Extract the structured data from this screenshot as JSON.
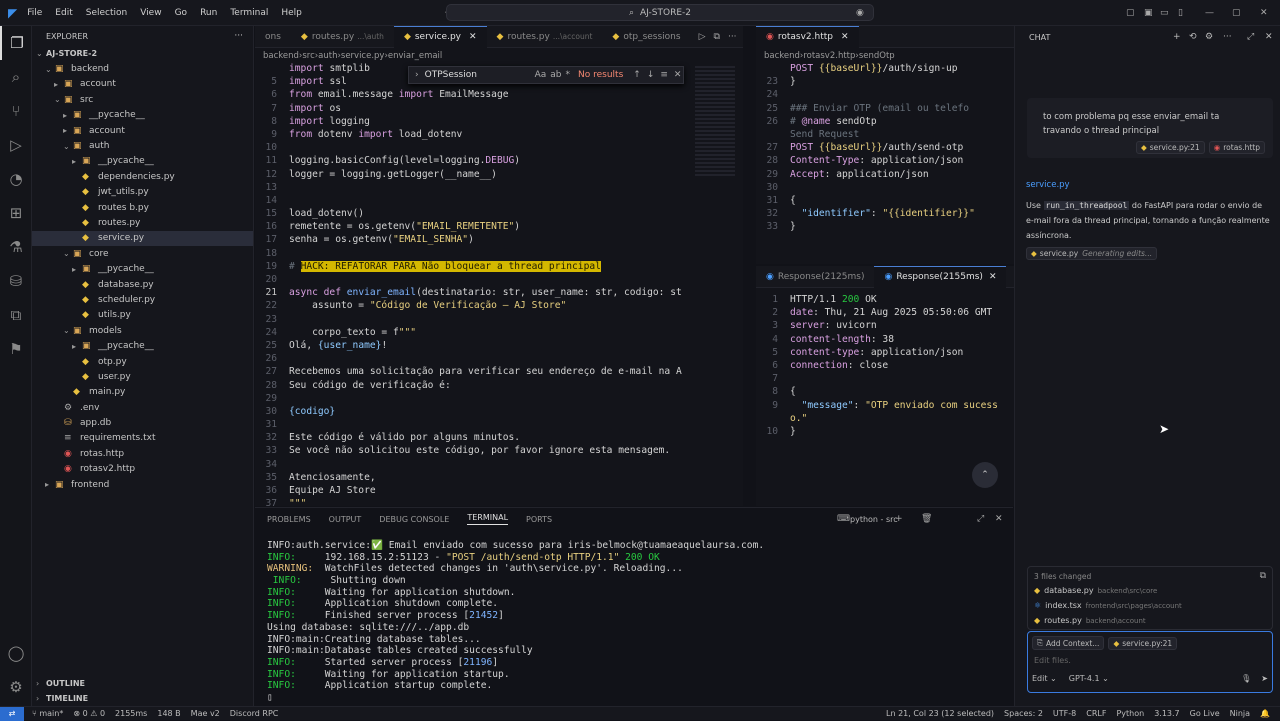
{
  "titlebar": {
    "menu": [
      "File",
      "Edit",
      "Selection",
      "View",
      "Go",
      "Run",
      "Terminal",
      "Help"
    ],
    "search": "AJ-STORE-2"
  },
  "explorer": {
    "header": "EXPLORER",
    "root": "AJ-STORE-2",
    "outline": "OUTLINE",
    "timeline": "TIMELINE",
    "items": [
      {
        "label": "backend",
        "depth": 1,
        "type": "folder-open"
      },
      {
        "label": "account",
        "depth": 2,
        "type": "folder"
      },
      {
        "label": "src",
        "depth": 2,
        "type": "folder-open"
      },
      {
        "label": "__pycache__",
        "depth": 3,
        "type": "folder"
      },
      {
        "label": "account",
        "depth": 3,
        "type": "folder"
      },
      {
        "label": "auth",
        "depth": 3,
        "type": "folder-open"
      },
      {
        "label": "__pycache__",
        "depth": 4,
        "type": "folder"
      },
      {
        "label": "dependencies.py",
        "depth": 4,
        "type": "py"
      },
      {
        "label": "jwt_utils.py",
        "depth": 4,
        "type": "py"
      },
      {
        "label": "routes b.py",
        "depth": 4,
        "type": "py"
      },
      {
        "label": "routes.py",
        "depth": 4,
        "type": "py"
      },
      {
        "label": "service.py",
        "depth": 4,
        "type": "py",
        "selected": true
      },
      {
        "label": "core",
        "depth": 3,
        "type": "folder-open"
      },
      {
        "label": "__pycache__",
        "depth": 4,
        "type": "folder"
      },
      {
        "label": "database.py",
        "depth": 4,
        "type": "py"
      },
      {
        "label": "scheduler.py",
        "depth": 4,
        "type": "py"
      },
      {
        "label": "utils.py",
        "depth": 4,
        "type": "py"
      },
      {
        "label": "models",
        "depth": 3,
        "type": "folder-open"
      },
      {
        "label": "__pycache__",
        "depth": 4,
        "type": "folder"
      },
      {
        "label": "otp.py",
        "depth": 4,
        "type": "py"
      },
      {
        "label": "user.py",
        "depth": 4,
        "type": "py"
      },
      {
        "label": "main.py",
        "depth": 3,
        "type": "py"
      },
      {
        "label": ".env",
        "depth": 2,
        "type": "env"
      },
      {
        "label": "app.db",
        "depth": 2,
        "type": "db"
      },
      {
        "label": "requirements.txt",
        "depth": 2,
        "type": "txt"
      },
      {
        "label": "rotas.http",
        "depth": 2,
        "type": "http"
      },
      {
        "label": "rotasv2.http",
        "depth": 2,
        "type": "http"
      },
      {
        "label": "frontend",
        "depth": 1,
        "type": "folder"
      }
    ]
  },
  "editor": {
    "tabs": [
      {
        "label": "ons",
        "active": false
      },
      {
        "label": "routes.py",
        "hint": "...\\auth",
        "active": false
      },
      {
        "label": "service.py",
        "active": true
      },
      {
        "label": "routes.py",
        "hint": "...\\account",
        "active": false
      },
      {
        "label": "otp_sessions",
        "active": false
      }
    ],
    "breadcrumb": [
      "backend",
      "src",
      "auth",
      "service.py",
      "enviar_email"
    ],
    "find": {
      "query": "OTPSession",
      "result": "No results",
      "opts": [
        "Aa",
        "ab",
        "*"
      ]
    },
    "lines": [
      {
        "n": "",
        "t": [
          [
            "kw",
            "import "
          ],
          [
            "nm",
            "smtplib"
          ]
        ]
      },
      {
        "n": "5",
        "t": [
          [
            "kw",
            "import "
          ],
          [
            "nm",
            "ssl"
          ]
        ]
      },
      {
        "n": "6",
        "t": [
          [
            "kw",
            "from "
          ],
          [
            "nm",
            "email.message "
          ],
          [
            "kw",
            "import "
          ],
          [
            "nm",
            "EmailMessage"
          ]
        ]
      },
      {
        "n": "7",
        "t": [
          [
            "kw",
            "import "
          ],
          [
            "nm",
            "os"
          ]
        ]
      },
      {
        "n": "8",
        "t": [
          [
            "kw",
            "import "
          ],
          [
            "nm",
            "logging"
          ]
        ]
      },
      {
        "n": "9",
        "t": [
          [
            "kw",
            "from "
          ],
          [
            "nm",
            "dotenv "
          ],
          [
            "kw",
            "import "
          ],
          [
            "nm",
            "load_dotenv"
          ]
        ]
      },
      {
        "n": "10",
        "t": []
      },
      {
        "n": "11",
        "t": [
          [
            "nm",
            "logging.basicConfig(level=logging."
          ],
          [
            "kw",
            "DEBUG"
          ],
          [
            "nm",
            ")"
          ]
        ]
      },
      {
        "n": "12",
        "t": [
          [
            "nm",
            "logger = logging.getLogger(__name__)"
          ]
        ]
      },
      {
        "n": "13",
        "t": []
      },
      {
        "n": "14",
        "t": []
      },
      {
        "n": "15",
        "t": [
          [
            "nm",
            "load_dotenv()"
          ]
        ]
      },
      {
        "n": "16",
        "t": [
          [
            "nm",
            "remetente = os.getenv("
          ],
          [
            "str",
            "\"EMAIL_REMETENTE\""
          ],
          [
            "nm",
            ")"
          ]
        ]
      },
      {
        "n": "17",
        "t": [
          [
            "nm",
            "senha = os.getenv("
          ],
          [
            "str",
            "\"EMAIL_SENHA\""
          ],
          [
            "nm",
            ")"
          ]
        ]
      },
      {
        "n": "18",
        "t": []
      },
      {
        "n": "19",
        "t": [
          [
            "cm",
            "# "
          ],
          [
            "hl",
            "HACK: REFATORAR PARA Não bloquear a thread principal"
          ]
        ]
      },
      {
        "n": "20",
        "t": []
      },
      {
        "n": "21",
        "cur": true,
        "t": [
          [
            "kw",
            "async def "
          ],
          [
            "fn",
            "enviar_email"
          ],
          [
            "nm",
            "(destinatario: str, user_name: str, codigo: st"
          ]
        ]
      },
      {
        "n": "22",
        "t": [
          [
            "nm",
            "    assunto = "
          ],
          [
            "str",
            "\"Código de Verificação – AJ Store\""
          ]
        ]
      },
      {
        "n": "23",
        "t": []
      },
      {
        "n": "24",
        "t": [
          [
            "nm",
            "    corpo_texto = f"
          ],
          [
            "str",
            "\"\"\""
          ]
        ]
      },
      {
        "n": "25",
        "t": [
          [
            "nm",
            "Olá, "
          ],
          [
            "var",
            "{user_name}"
          ],
          [
            "nm",
            "!"
          ]
        ]
      },
      {
        "n": "26",
        "t": []
      },
      {
        "n": "27",
        "t": [
          [
            "nm",
            "Recebemos uma solicitação para verificar seu endereço de e-mail na A"
          ]
        ]
      },
      {
        "n": "28",
        "t": [
          [
            "nm",
            "Seu código de verificação é:"
          ]
        ]
      },
      {
        "n": "29",
        "t": []
      },
      {
        "n": "30",
        "t": [
          [
            "var",
            "{codigo}"
          ]
        ]
      },
      {
        "n": "31",
        "t": []
      },
      {
        "n": "32",
        "t": [
          [
            "nm",
            "Este código é válido por alguns minutos."
          ]
        ]
      },
      {
        "n": "33",
        "t": [
          [
            "nm",
            "Se você não solicitou este código, por favor ignore esta mensagem."
          ]
        ]
      },
      {
        "n": "34",
        "t": []
      },
      {
        "n": "35",
        "t": [
          [
            "nm",
            "Atenciosamente,"
          ]
        ]
      },
      {
        "n": "36",
        "t": [
          [
            "nm",
            "Equipe AJ Store"
          ]
        ]
      },
      {
        "n": "37",
        "t": [
          [
            "str",
            "\"\"\""
          ]
        ]
      }
    ]
  },
  "http": {
    "tab": "rotasv2.http",
    "breadcrumb": [
      "backend",
      "rotasv2.http",
      "sendOtp"
    ],
    "lines": [
      {
        "n": "",
        "t": [
          [
            "kw",
            "POST "
          ],
          [
            "str",
            "{{baseUrl}}"
          ],
          [
            "nm",
            "/auth/sign-up"
          ]
        ]
      },
      {
        "n": "23",
        "t": [
          [
            "nm",
            "}"
          ]
        ]
      },
      {
        "n": "24",
        "t": []
      },
      {
        "n": "25",
        "t": [
          [
            "cm",
            "### Enviar OTP (email ou telefo"
          ]
        ]
      },
      {
        "n": "26",
        "t": [
          [
            "cm",
            "# "
          ],
          [
            "kw",
            "@name "
          ],
          [
            "nm",
            "sendOtp"
          ]
        ]
      },
      {
        "n": "",
        "t": [
          [
            "cm",
            "Send Request"
          ]
        ]
      },
      {
        "n": "27",
        "t": [
          [
            "kw",
            "POST "
          ],
          [
            "str",
            "{{baseUrl}}"
          ],
          [
            "nm",
            "/auth/send-otp"
          ]
        ]
      },
      {
        "n": "28",
        "t": [
          [
            "kw",
            "Content-Type"
          ],
          [
            "nm",
            ": application/json"
          ]
        ]
      },
      {
        "n": "29",
        "t": [
          [
            "kw",
            "Accept"
          ],
          [
            "nm",
            ": application/json"
          ]
        ]
      },
      {
        "n": "30",
        "t": []
      },
      {
        "n": "31",
        "t": [
          [
            "nm",
            "{"
          ]
        ]
      },
      {
        "n": "32",
        "t": [
          [
            "nm",
            "  "
          ],
          [
            "var",
            "\"identifier\""
          ],
          [
            "nm",
            ": "
          ],
          [
            "str",
            "\"{{identifier}}\""
          ]
        ]
      },
      {
        "n": "33",
        "t": [
          [
            "nm",
            "}"
          ]
        ]
      }
    ]
  },
  "response": {
    "tabs": [
      {
        "label": "Response(2125ms)",
        "active": false
      },
      {
        "label": "Response(2155ms)",
        "active": true
      }
    ],
    "lines": [
      {
        "n": "1",
        "t": [
          [
            "nm",
            "HTTP/1.1 "
          ],
          [
            "ok",
            "200 "
          ],
          [
            "nm",
            "OK"
          ]
        ]
      },
      {
        "n": "2",
        "t": [
          [
            "kw",
            "date"
          ],
          [
            "nm",
            ": Thu, 21 Aug 2025 05:50:06 GMT"
          ]
        ]
      },
      {
        "n": "3",
        "t": [
          [
            "kw",
            "server"
          ],
          [
            "nm",
            ": uvicorn"
          ]
        ]
      },
      {
        "n": "4",
        "t": [
          [
            "kw",
            "content-length"
          ],
          [
            "nm",
            ": 38"
          ]
        ]
      },
      {
        "n": "5",
        "t": [
          [
            "kw",
            "content-type"
          ],
          [
            "nm",
            ": application/json"
          ]
        ]
      },
      {
        "n": "6",
        "t": [
          [
            "kw",
            "connection"
          ],
          [
            "nm",
            ": close"
          ]
        ]
      },
      {
        "n": "7",
        "t": []
      },
      {
        "n": "8",
        "t": [
          [
            "nm",
            "{"
          ]
        ]
      },
      {
        "n": "9",
        "t": [
          [
            "nm",
            "  "
          ],
          [
            "var",
            "\"message\""
          ],
          [
            "nm",
            ": "
          ],
          [
            "str",
            "\"OTP enviado com sucess"
          ]
        ]
      },
      {
        "n": "",
        "t": [
          [
            "str",
            "o.\""
          ]
        ]
      },
      {
        "n": "10",
        "t": [
          [
            "nm",
            "}"
          ]
        ]
      }
    ]
  },
  "panel": {
    "tabs": [
      "PROBLEMS",
      "OUTPUT",
      "DEBUG CONSOLE",
      "TERMINAL",
      "PORTS"
    ],
    "active": "TERMINAL",
    "shell": "python - src",
    "lines": [
      [
        [
          "nm",
          "INFO:auth.service:"
        ],
        [
          "ok",
          "✅"
        ],
        [
          "nm",
          " Email enviado com sucesso para iris-belmock@tuamaeaquelaursa.com."
        ]
      ],
      [
        [
          "info",
          "INFO:"
        ],
        [
          "nm",
          "     192.168.15.2:51123 - "
        ],
        [
          "str",
          "\"POST /auth/send-otp HTTP/1.1\""
        ],
        [
          "ok",
          " 200 OK"
        ]
      ],
      [
        [
          "warn",
          "WARNING:"
        ],
        [
          "nm",
          "  WatchFiles detected changes in 'auth\\service.py'. Reloading..."
        ]
      ],
      [
        [
          "info",
          " INFO:"
        ],
        [
          "nm",
          "     Shutting down"
        ]
      ],
      [
        [
          "info",
          "INFO:"
        ],
        [
          "nm",
          "     Waiting for application shutdown."
        ]
      ],
      [
        [
          "info",
          "INFO:"
        ],
        [
          "nm",
          "     Application shutdown complete."
        ]
      ],
      [
        [
          "info",
          "INFO:"
        ],
        [
          "nm",
          "     Finished server process ["
        ],
        [
          "fn",
          "21452"
        ],
        [
          "nm",
          "]"
        ]
      ],
      [
        [
          "nm",
          "Using database: sqlite:///../app.db"
        ]
      ],
      [
        [
          "nm",
          "INFO:main:Creating database tables..."
        ]
      ],
      [
        [
          "nm",
          "INFO:main:Database tables created successfully"
        ]
      ],
      [
        [
          "info",
          "INFO:"
        ],
        [
          "nm",
          "     Started server process ["
        ],
        [
          "fn",
          "21196"
        ],
        [
          "nm",
          "]"
        ]
      ],
      [
        [
          "info",
          "INFO:"
        ],
        [
          "nm",
          "     Waiting for application startup."
        ]
      ],
      [
        [
          "info",
          "INFO:"
        ],
        [
          "nm",
          "     Application startup complete."
        ]
      ],
      [
        [
          "nm",
          "▯"
        ]
      ]
    ]
  },
  "chat": {
    "title": "CHAT",
    "user_msg": "to com problema pq esse enviar_email ta travando o thread principal",
    "user_refs": [
      "service.py:21",
      "rotas.http"
    ],
    "ai_file": "service.py",
    "ai_msg_parts": [
      "Use ",
      "run_in_threadpool",
      " do FastAPI para rodar o envio de e-mail fora da thread principal, tornando a função realmente assíncrona."
    ],
    "ai_status_file": "service.py",
    "ai_status": "Generating edits...",
    "files_changed_label": "3 files changed",
    "files_changed": [
      {
        "name": "database.py",
        "path": "backend\\src\\core"
      },
      {
        "name": "index.tsx",
        "path": "frontend\\src\\pages\\account"
      },
      {
        "name": "routes.py",
        "path": "backend\\account"
      }
    ],
    "add_context": "Add Context...",
    "context_chip": "service.py:21",
    "input_placeholder": "Edit files.",
    "mode": "Edit",
    "model": "GPT-4.1"
  },
  "statusbar": {
    "branch": "main*",
    "errors": "⊗ 0  ⚠ 0",
    "time": "2155ms",
    "size": "148 B",
    "git": "Mae v2",
    "rpc": "Discord RPC",
    "cursor": "Ln 21, Col 23 (12 selected)",
    "spaces": "Spaces: 2",
    "encoding": "UTF-8",
    "eol": "CRLF",
    "lang": "Python",
    "version": "3.13.7",
    "golive": "Go Live",
    "ninja": "Ninja"
  }
}
